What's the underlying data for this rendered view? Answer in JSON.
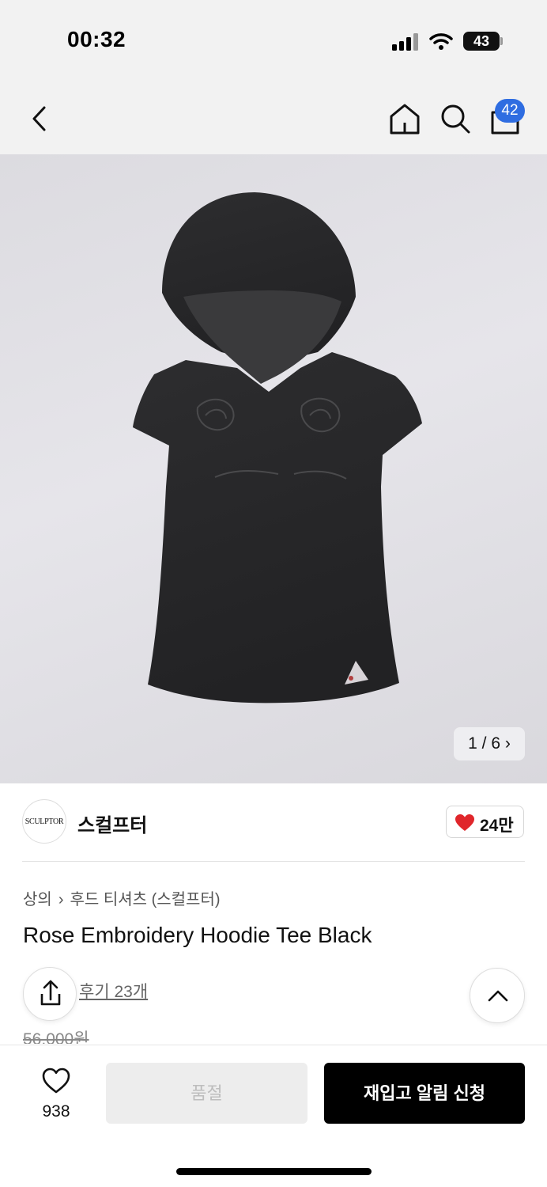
{
  "status_bar": {
    "time": "00:32",
    "battery": "43"
  },
  "top_nav": {
    "cart_count": "42"
  },
  "gallery": {
    "counter": "1 / 6 ›"
  },
  "brand": {
    "logo_text": "SCULPTOR",
    "name": "스컬프터",
    "like_count": "24만"
  },
  "product": {
    "breadcrumb": [
      "상의",
      "후드 티셔츠 (스컬프터)"
    ],
    "breadcrumb_separator": "›",
    "title": "Rose Embroidery Hoodie Tee Black",
    "reviews": "후기 23개",
    "original_price": "56,000원"
  },
  "bottom_bar": {
    "wish_count": "938",
    "soldout_label": "품절",
    "restock_label": "재입고 알림 신청"
  },
  "colors": {
    "accent_badge": "#2f6de1",
    "like_heart": "#e0262b",
    "primary_button": "#000000"
  },
  "icons": [
    "back-icon",
    "home-icon",
    "search-icon",
    "shopping-bag-icon",
    "heart-icon",
    "share-icon",
    "chevron-up-icon"
  ]
}
